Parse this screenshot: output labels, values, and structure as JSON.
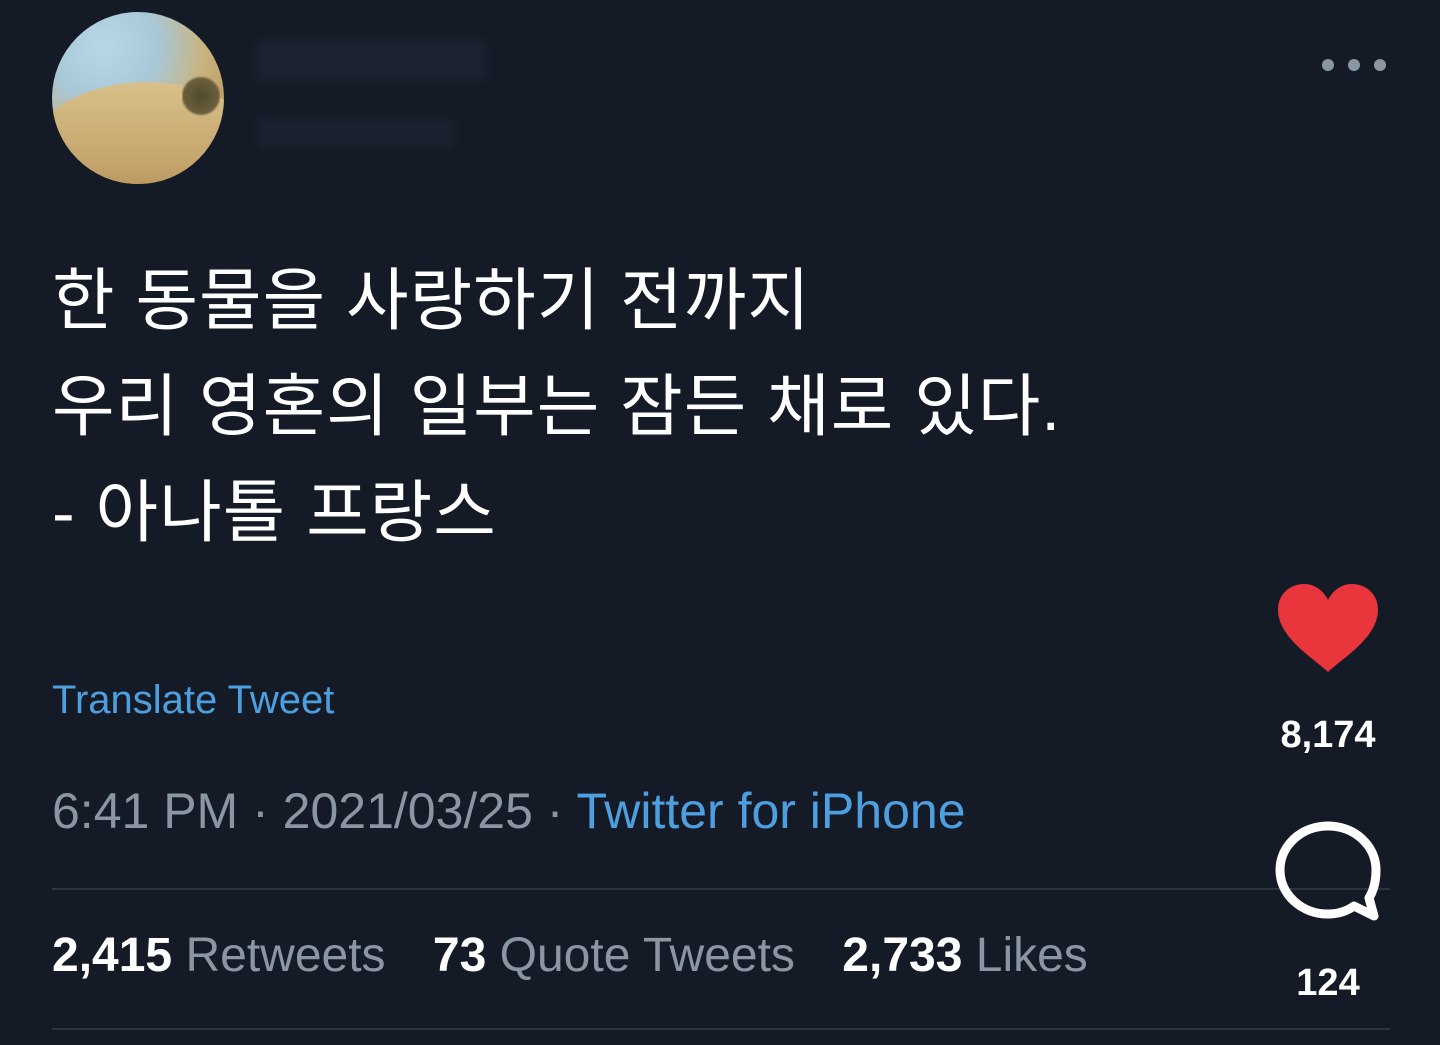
{
  "tweet": {
    "text_lines": [
      "한 동물을 사랑하기 전까지",
      "우리 영혼의 일부는 잠든 채로 있다.",
      "- 아나톨 프랑스"
    ],
    "translate_label": "Translate Tweet",
    "time": "6:41 PM",
    "date": "2021/03/25",
    "separator": " · ",
    "source": "Twitter for iPhone",
    "more_icon": "more-horizontal-icon"
  },
  "stats": {
    "retweets_count": "2,415",
    "retweets_label": "Retweets",
    "quotes_count": "73",
    "quotes_label": "Quote Tweets",
    "likes_count": "2,733",
    "likes_label": "Likes"
  },
  "side_actions": {
    "likes_count": "8,174",
    "comments_count": "124",
    "heart_color": "#e9363d",
    "heart_icon": "heart-icon",
    "comment_icon": "comment-icon"
  },
  "colors": {
    "background": "#151b26",
    "link": "#4e9fe0",
    "muted": "#8b96a3"
  }
}
